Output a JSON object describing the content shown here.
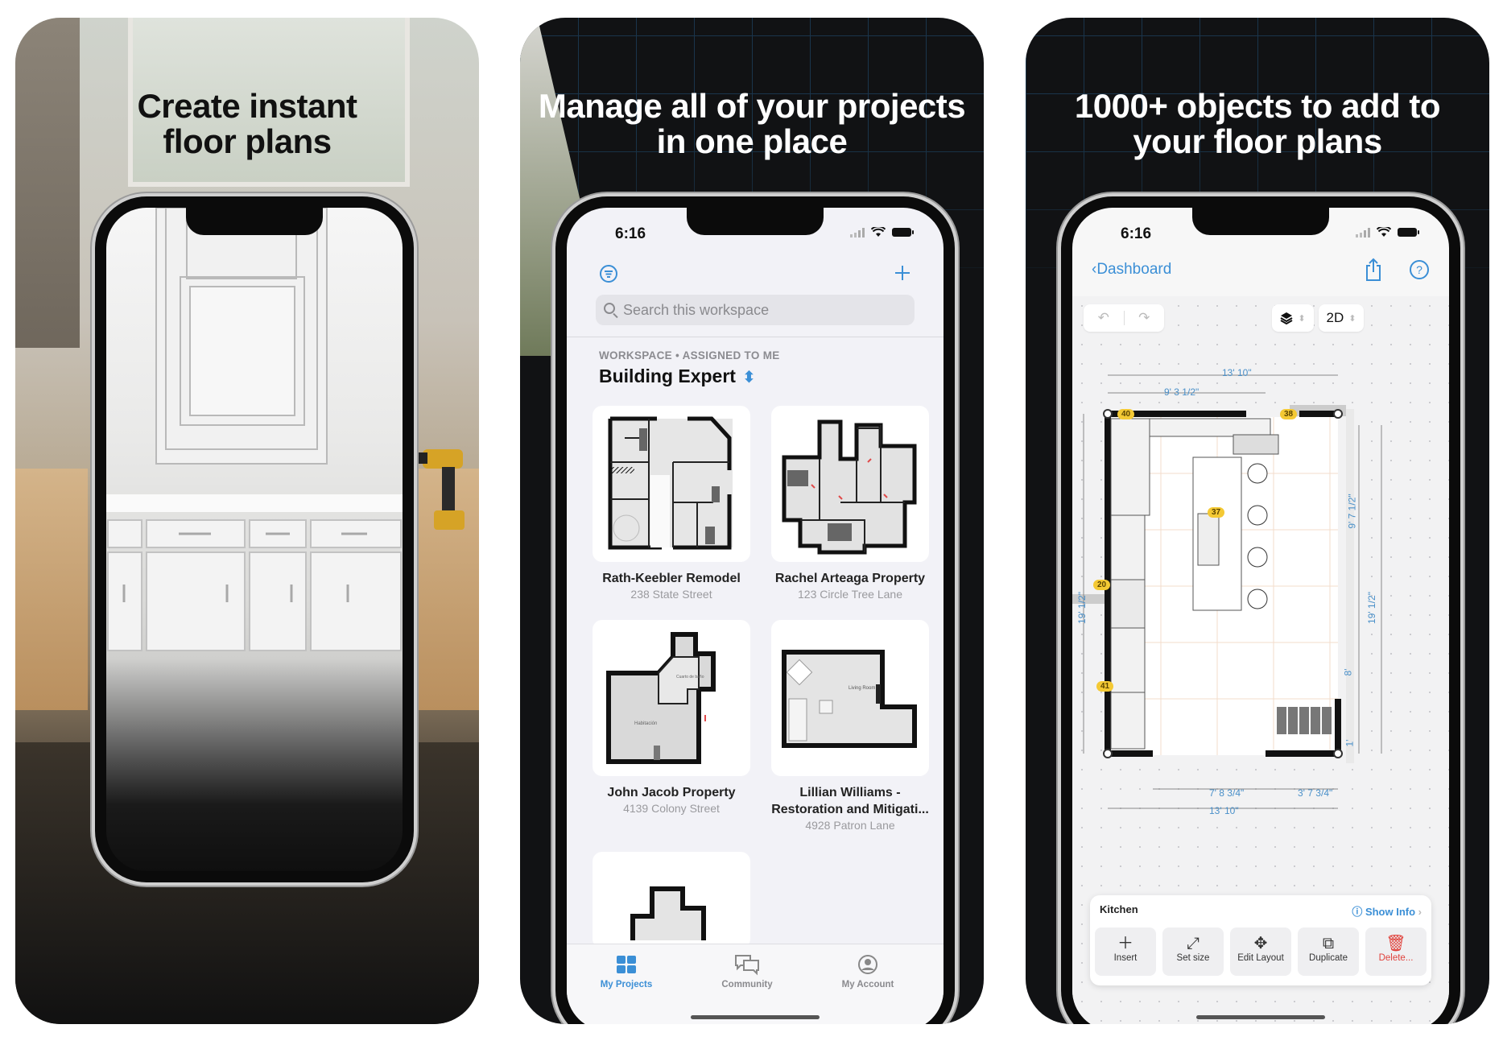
{
  "panels": [
    {
      "headline_line1": "Create instant",
      "headline_line2": "floor plans"
    },
    {
      "headline_line1": "Manage all of your projects",
      "headline_line2": "in one place",
      "status": {
        "time": "6:16"
      },
      "nav": {
        "filter_icon": "filter-icon",
        "add_icon": "plus-icon"
      },
      "search": {
        "placeholder": "Search this workspace"
      },
      "workspace": {
        "label": "WORKSPACE • ASSIGNED TO ME",
        "title": "Building Expert"
      },
      "projects": [
        {
          "title": "Rath-Keebler Remodel",
          "address": "238 State Street"
        },
        {
          "title": "Rachel Arteaga Property",
          "address": "123 Circle Tree Lane"
        },
        {
          "title": "John Jacob Property",
          "address": "4139 Colony Street"
        },
        {
          "title": "Lillian Williams - Restoration and Mitigati...",
          "address": "4928 Patron Lane"
        }
      ],
      "thumb_labels": {
        "john_room1": "Habitación",
        "john_room2": "Cuarto de baño",
        "lillian_room": "Living Room"
      },
      "tabs": [
        {
          "label": "My Projects",
          "active": true
        },
        {
          "label": "Community",
          "active": false
        },
        {
          "label": "My Account",
          "active": false
        }
      ]
    },
    {
      "headline_line1": "1000+ objects to add to",
      "headline_line2": "your floor plans",
      "status": {
        "time": "6:16"
      },
      "nav": {
        "back_label": "Dashboard"
      },
      "toolbar": {
        "view_mode": "2D"
      },
      "dimensions": {
        "top_total": "13' 10\"",
        "top_partial": "9' 3 1/2\"",
        "bottom_left": "7' 8 3/4\"",
        "bottom_right": "3' 7 3/4\"",
        "bottom_total": "13' 10\"",
        "left_height": "19' 1/2\"",
        "right_height": "19' 1/2\"",
        "right_upper": "9' 7 1/2\"",
        "right_lower": "8'",
        "right_bottom": "1'"
      },
      "markers": [
        "40",
        "38",
        "37",
        "20",
        "41"
      ],
      "room_sheet": {
        "room_name": "Kitchen",
        "show_info": "Show Info",
        "actions": [
          {
            "label": "Insert",
            "icon": "plus-icon"
          },
          {
            "label": "Set size",
            "icon": "resize-icon"
          },
          {
            "label": "Edit Layout",
            "icon": "move-icon"
          },
          {
            "label": "Duplicate",
            "icon": "duplicate-icon"
          },
          {
            "label": "Delete...",
            "icon": "trash-icon"
          }
        ]
      }
    }
  ],
  "colors": {
    "accent": "#3b8fd6",
    "marker": "#f4c934",
    "delete": "#e0423c",
    "panel_dark": "#111214"
  }
}
